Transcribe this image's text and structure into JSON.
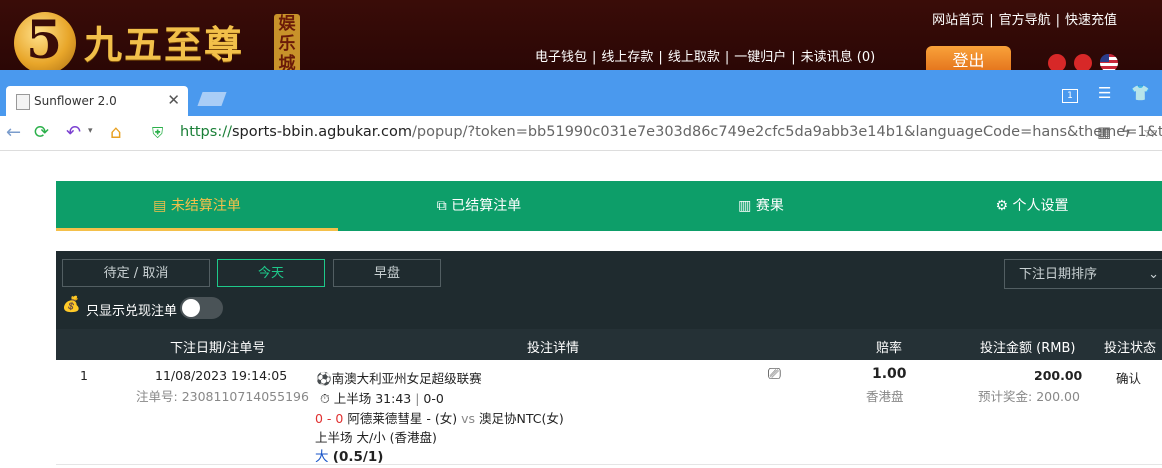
{
  "site": {
    "brand_name": "九五至尊",
    "brand_tag": "娱乐城",
    "top_links": [
      "网站首页",
      "官方导航",
      "快速充值"
    ],
    "mid_links": [
      "电子钱包",
      "线上存款",
      "线上取款",
      "一键归户",
      "未读讯息 (0)"
    ],
    "login_label": "登出"
  },
  "browser": {
    "tab_title": "Sunflower 2.0",
    "url_scheme": "https://",
    "url_host": "sports-bbin.agbukar.com",
    "url_path": "/popup/?token=bb51990c031e7e303d86c749e2cfc5da9abb3e14b1&languageCode=hans&theme=1&t",
    "window_badge": "1"
  },
  "nav": {
    "tabs": [
      {
        "label": "未结算注单",
        "icon": "document-icon"
      },
      {
        "label": "已结算注单",
        "icon": "copy-icon"
      },
      {
        "label": "赛果",
        "icon": "scoreboard-icon"
      },
      {
        "label": "个人设置",
        "icon": "gear-icon"
      }
    ],
    "active_index": 0
  },
  "filters": {
    "buttons": [
      "待定 / 取消",
      "今天",
      "早盘"
    ],
    "active_index": 1,
    "sort_label": "下注日期排序",
    "toggle_label": "只显示兑现注单",
    "toggle_on": false
  },
  "table": {
    "headers": [
      "下注日期/注单号",
      "投注详情",
      "赔率",
      "投注金额 (RMB)",
      "投注状态"
    ],
    "rows": [
      {
        "index": "1",
        "date": "11/08/2023 19:14:05",
        "bet_no_label": "注单号:",
        "bet_no": "2308110714055196",
        "league": "南澳大利亚州女足超级联赛",
        "period_time": "上半场 31:43",
        "period_score": "0-0",
        "score": "0 - 0",
        "home": "阿德莱德彗星 - (女)",
        "vs": "vs",
        "away": "澳足协NTC(女)",
        "market": "上半场 大/小 (香港盘)",
        "selection": "大",
        "line": "(0.5/1)",
        "odds": "1.00",
        "odds_type": "香港盘",
        "amount": "200.00",
        "est_label": "预计奖金:",
        "est_value": "200.00",
        "status": "确认"
      }
    ]
  },
  "colors": {
    "nav_green": "#0d9e69",
    "active_gold": "#f4c04a",
    "dark_panel": "#1f2b2f",
    "browser_blue": "#4a99ee"
  }
}
